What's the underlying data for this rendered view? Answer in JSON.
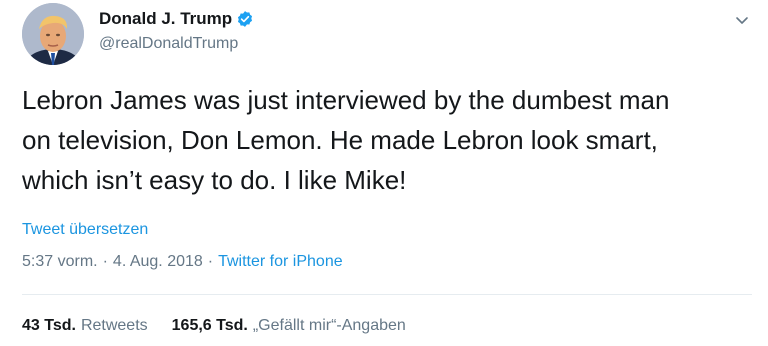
{
  "author": {
    "name": "Donald J. Trump",
    "handle": "@realDonaldTrump",
    "verified": true
  },
  "tweet": {
    "text": "Lebron James was just interviewed by the dumbest man\non television, Don Lemon. He made Lebron look smart,\nwhich isn’t easy to do. I like Mike!",
    "translate_label": "Tweet übersetzen",
    "time": "5:37 vorm.",
    "separator": "·",
    "date": "4. Aug. 2018",
    "source": "Twitter for iPhone"
  },
  "stats": {
    "retweets_count": "43 Tsd.",
    "retweets_label": "Retweets",
    "likes_count": "165,6 Tsd.",
    "likes_label": "„Gefällt mir“-Angaben"
  },
  "icons": {
    "verified": "verified-badge-icon",
    "caret": "chevron-down-icon"
  },
  "colors": {
    "link": "#1b95e0",
    "muted": "#657786",
    "text": "#14171a",
    "verified": "#1da1f2"
  }
}
